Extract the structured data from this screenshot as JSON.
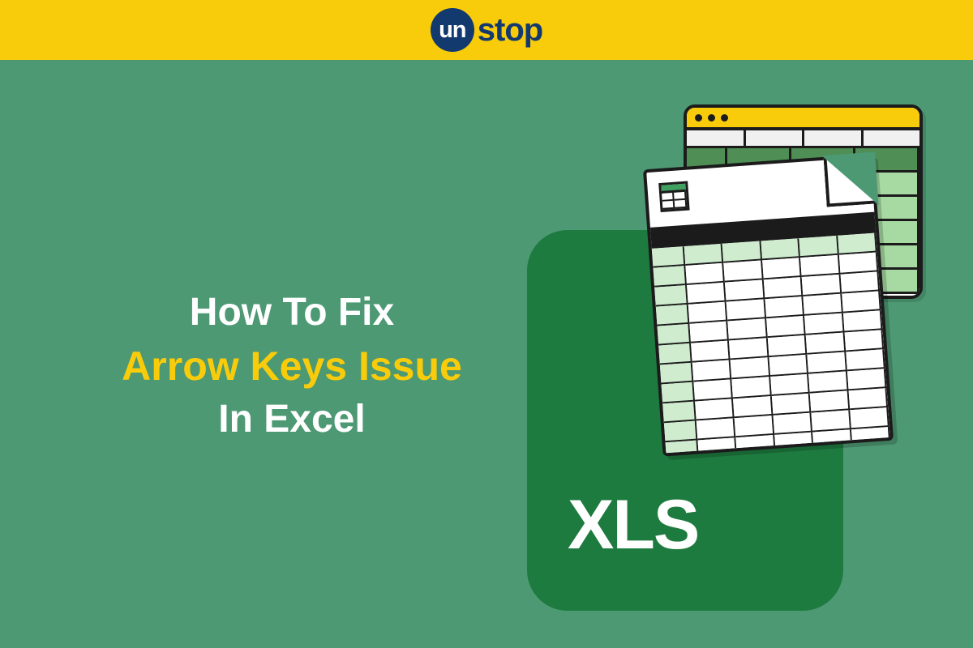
{
  "banner": {
    "logo_inner": "un",
    "logo_outer": "stop"
  },
  "headline": {
    "line1": "How To Fix",
    "line2": "Arrow Keys Issue",
    "line3": "In Excel"
  },
  "illustration": {
    "card_label": "XLS"
  },
  "colors": {
    "banner": "#f9cc0b",
    "main_bg": "#4d9973",
    "logo_blue": "#123a6e",
    "xls_green": "#1e7b3f",
    "accent_yellow": "#f9cc0b"
  }
}
